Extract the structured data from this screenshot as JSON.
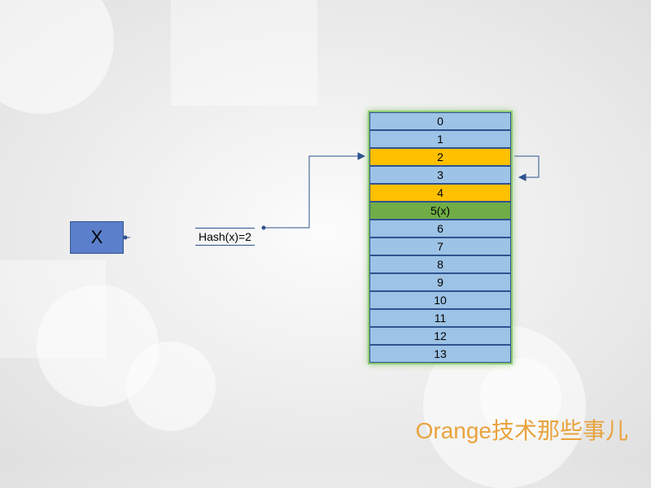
{
  "input_box": {
    "label": "X"
  },
  "hash_label": "Hash(x)=2",
  "table": {
    "cells": [
      {
        "label": "0",
        "class": ""
      },
      {
        "label": "1",
        "class": ""
      },
      {
        "label": "2",
        "class": "orange"
      },
      {
        "label": "3",
        "class": ""
      },
      {
        "label": "4",
        "class": "orange"
      },
      {
        "label": "5(x)",
        "class": "green"
      },
      {
        "label": "6",
        "class": ""
      },
      {
        "label": "7",
        "class": ""
      },
      {
        "label": "8",
        "class": ""
      },
      {
        "label": "9",
        "class": ""
      },
      {
        "label": "10",
        "class": ""
      },
      {
        "label": "11",
        "class": ""
      },
      {
        "label": "12",
        "class": ""
      },
      {
        "label": "13",
        "class": ""
      }
    ]
  },
  "watermark": "Orange技术那些事儿"
}
